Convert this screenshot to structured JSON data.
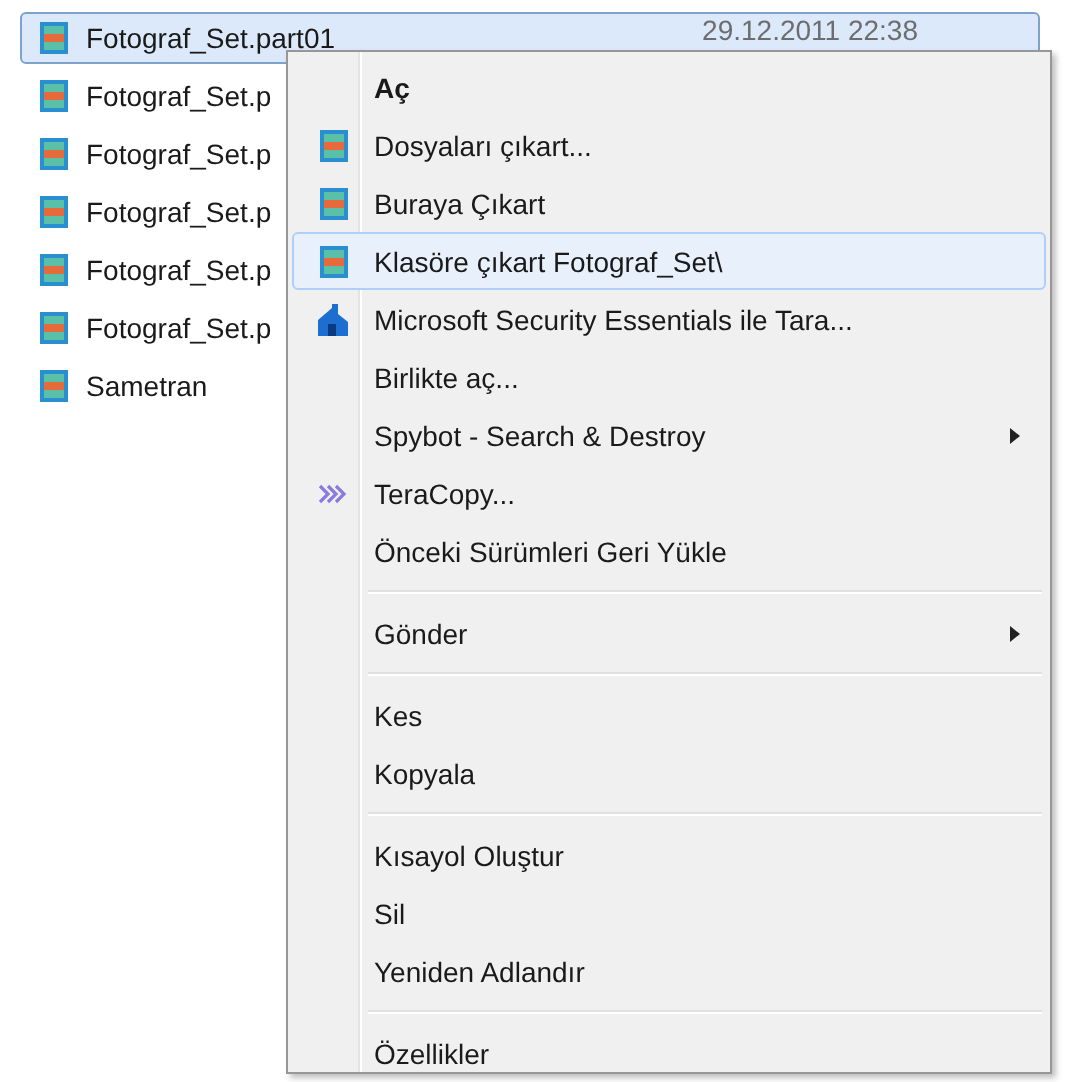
{
  "files": [
    {
      "name": "Fotograf_Set.part01",
      "date": "29.12.2011 22:38",
      "selected": true
    },
    {
      "name": "Fotograf_Set.p",
      "selected": false
    },
    {
      "name": "Fotograf_Set.p",
      "selected": false
    },
    {
      "name": "Fotograf_Set.p",
      "selected": false
    },
    {
      "name": "Fotograf_Set.p",
      "selected": false
    },
    {
      "name": "Fotograf_Set.p",
      "selected": false
    },
    {
      "name": "Sametran",
      "selected": false
    }
  ],
  "context_menu": {
    "groups": [
      [
        {
          "label": "Aç",
          "default": true,
          "kind": "plain",
          "submenu": false,
          "selected": false
        },
        {
          "label": "Dosyaları çıkart...",
          "default": false,
          "kind": "archive",
          "submenu": false,
          "selected": false
        },
        {
          "label": "Buraya Çıkart",
          "default": false,
          "kind": "archive",
          "submenu": false,
          "selected": false
        },
        {
          "label": "Klasöre çıkart Fotograf_Set\\",
          "default": false,
          "kind": "archive",
          "submenu": false,
          "selected": true
        },
        {
          "label": "Microsoft Security Essentials ile Tara...",
          "default": false,
          "kind": "scan",
          "submenu": false,
          "selected": false
        },
        {
          "label": "Birlikte aç...",
          "default": false,
          "kind": "plain",
          "submenu": false,
          "selected": false
        },
        {
          "label": "Spybot - Search & Destroy",
          "default": false,
          "kind": "plain",
          "submenu": true,
          "selected": false
        },
        {
          "label": "TeraCopy...",
          "default": false,
          "kind": "copy",
          "submenu": false,
          "selected": false
        },
        {
          "label": "Önceki Sürümleri Geri Yükle",
          "default": false,
          "kind": "plain",
          "submenu": false,
          "selected": false
        }
      ],
      [
        {
          "label": "Gönder",
          "default": false,
          "kind": "plain",
          "submenu": true,
          "selected": false
        }
      ],
      [
        {
          "label": "Kes",
          "default": false,
          "kind": "plain",
          "submenu": false,
          "selected": false
        },
        {
          "label": "Kopyala",
          "default": false,
          "kind": "plain",
          "submenu": false,
          "selected": false
        }
      ],
      [
        {
          "label": "Kısayol Oluştur",
          "default": false,
          "kind": "plain",
          "submenu": false,
          "selected": false
        },
        {
          "label": "Sil",
          "default": false,
          "kind": "plain",
          "submenu": false,
          "selected": false
        },
        {
          "label": "Yeniden Adlandır",
          "default": false,
          "kind": "plain",
          "submenu": false,
          "selected": false
        }
      ],
      [
        {
          "label": "Özellikler",
          "default": false,
          "kind": "plain",
          "submenu": false,
          "selected": false
        }
      ]
    ]
  }
}
